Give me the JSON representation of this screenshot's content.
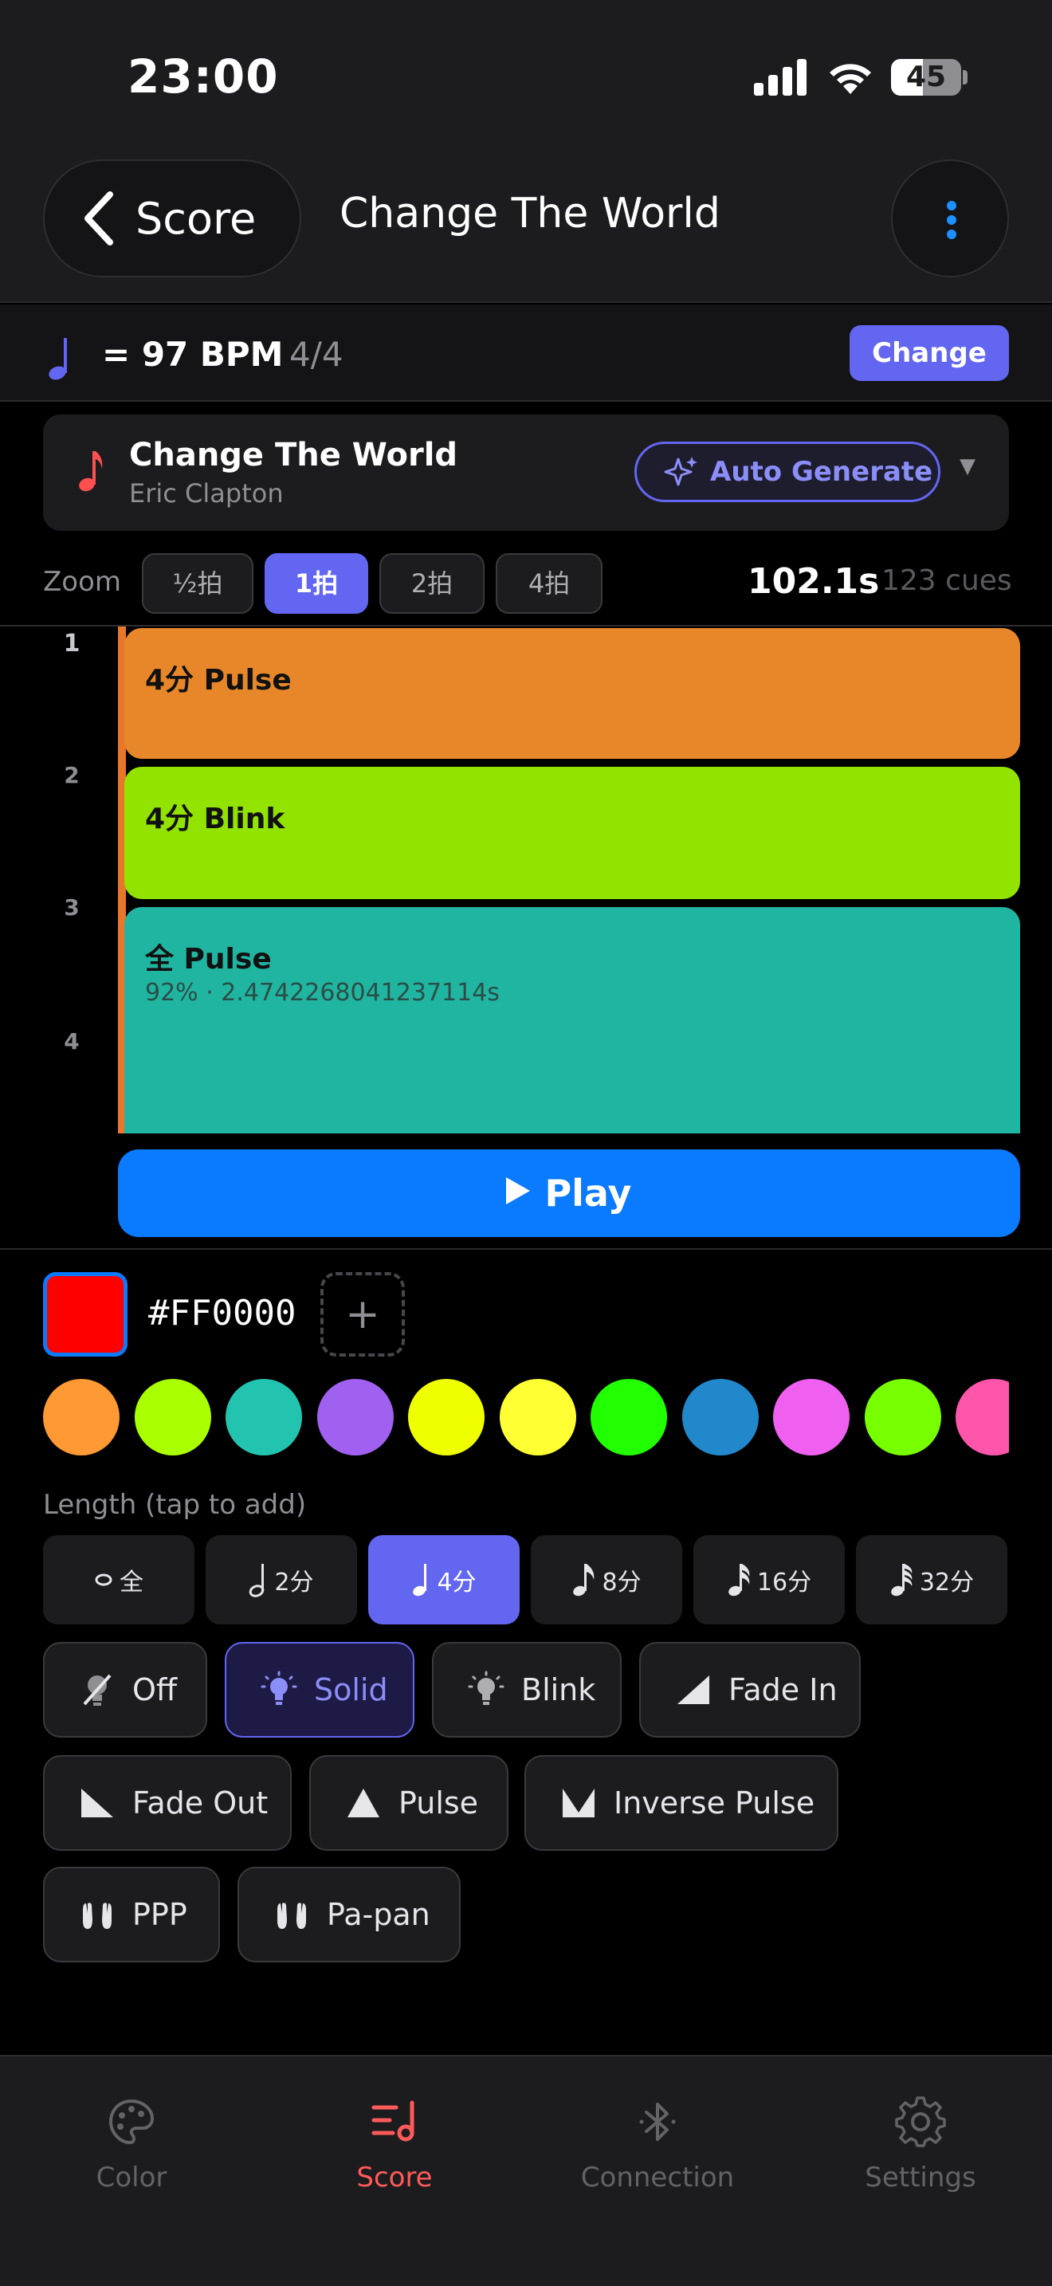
{
  "status": {
    "time": "23:00",
    "battery": "45",
    "battery_level": 0.45
  },
  "nav": {
    "back_label": "Score",
    "title": "Change The World"
  },
  "tempo": {
    "bpm_text": "= 97 BPM",
    "time_signature": "4/4",
    "change_label": "Change"
  },
  "song": {
    "title": "Change The World",
    "artist": "Eric Clapton",
    "auto_generate_label": "Auto Generate"
  },
  "zoom": {
    "label": "Zoom",
    "options": [
      "½拍",
      "1拍",
      "2拍",
      "4拍"
    ],
    "selected": "1拍",
    "duration": "102.1s",
    "cues_count": "123 cues"
  },
  "timeline": {
    "beat_numbers": [
      "1",
      "2",
      "3",
      "4"
    ],
    "cues": [
      {
        "label": "4分 Pulse",
        "color": "#e8872a"
      },
      {
        "label": "4分 Blink",
        "color": "#93e300"
      },
      {
        "label": "全 Pulse",
        "sub": "92% · 2.4742268041237114s",
        "color": "#20b5a0"
      }
    ],
    "play_label": "Play"
  },
  "color_picker": {
    "current_color": "#FF0000",
    "hex_label": "#FF0000",
    "add_symbol": "+",
    "palette": [
      "#ff9933",
      "#aaff00",
      "#22c4b0",
      "#a060f0",
      "#f0ff00",
      "#ffff33",
      "#22ff00",
      "#2288cc",
      "#f060f0",
      "#77ff00",
      "#ff55aa"
    ]
  },
  "length": {
    "label": "Length (tap to add)",
    "options": [
      "全",
      "2分",
      "4分",
      "8分",
      "16分",
      "32分"
    ],
    "selected": "4分"
  },
  "effects": {
    "items": [
      "Off",
      "Solid",
      "Blink",
      "Fade In",
      "Fade Out",
      "Pulse",
      "Inverse Pulse",
      "PPP",
      "Pa-pan"
    ],
    "selected": "Solid"
  },
  "tabs": {
    "items": [
      "Color",
      "Score",
      "Connection",
      "Settings"
    ],
    "selected": "Score",
    "active_color": "#ff5a5a"
  }
}
